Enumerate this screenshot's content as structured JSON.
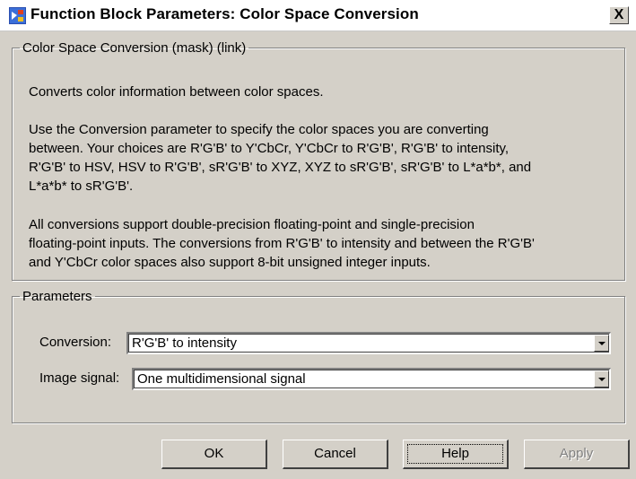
{
  "window": {
    "title": "Function Block Parameters: Color Space  Conversion",
    "close_label": "X"
  },
  "description_group": {
    "legend": "Color Space Conversion (mask) (link)",
    "lines": [
      "Converts color information between color spaces.",
      "Use the Conversion parameter to specify the color spaces you are converting",
      "between. Your choices are R'G'B' to Y'CbCr, Y'CbCr to R'G'B', R'G'B' to intensity,",
      "R'G'B' to HSV, HSV to R'G'B', sR'G'B' to XYZ, XYZ to sR'G'B', sR'G'B' to L*a*b*, and",
      "L*a*b* to sR'G'B'.",
      "All conversions support double-precision floating-point and single-precision",
      "floating-point inputs. The conversions from R'G'B' to intensity and between the R'G'B'",
      "and Y'CbCr color spaces also support 8-bit unsigned integer inputs."
    ]
  },
  "parameters_group": {
    "legend": "Parameters",
    "conversion_label": "Conversion:",
    "conversion_value": "R'G'B' to intensity",
    "image_signal_label": "Image signal:",
    "image_signal_value": "One multidimensional signal"
  },
  "buttons": {
    "ok": "OK",
    "cancel": "Cancel",
    "help": "Help",
    "apply": "Apply"
  },
  "icons": {
    "title": "simulink-block-icon",
    "close": "close-icon",
    "dropdown": "chevron-down-icon"
  }
}
